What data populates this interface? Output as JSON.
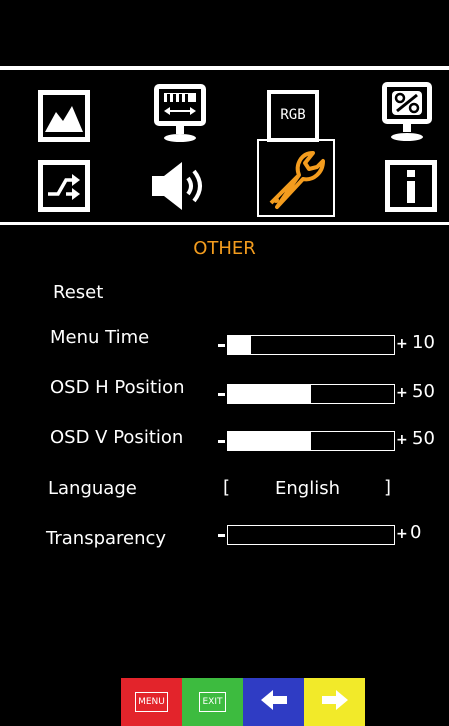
{
  "header": {},
  "icons": [
    {
      "name": "picture-icon"
    },
    {
      "name": "display-adjust-icon"
    },
    {
      "name": "rgb-icon",
      "label": "RGB"
    },
    {
      "name": "percent-monitor-icon"
    },
    {
      "name": "input-switch-icon"
    },
    {
      "name": "speaker-icon"
    },
    {
      "name": "wrench-icon",
      "selected": true,
      "color": "#f39c1e"
    },
    {
      "name": "info-icon"
    }
  ],
  "menu": {
    "title": "OTHER",
    "title_color": "#f39c1e",
    "items": [
      {
        "label": "Reset"
      },
      {
        "label": "Menu Time",
        "value": "10",
        "fraction": 0.14
      },
      {
        "label": "OSD H Position",
        "value": "50",
        "fraction": 0.5
      },
      {
        "label": "OSD V Position",
        "value": "50",
        "fraction": 0.5
      },
      {
        "label": "Language",
        "left_bracket": "[",
        "option": "English",
        "right_bracket": "]"
      },
      {
        "label": "Transparency",
        "value": "0",
        "fraction": 0
      }
    ]
  },
  "buttons": {
    "menu": {
      "label": "MENU",
      "color": "#e3242b"
    },
    "exit": {
      "label": "EXIT",
      "color": "#3dbb3f"
    },
    "left": {
      "icon": "arrow-left-icon",
      "color": "#2f3cc4"
    },
    "right": {
      "icon": "arrow-right-icon",
      "color": "#f2ea29"
    }
  }
}
